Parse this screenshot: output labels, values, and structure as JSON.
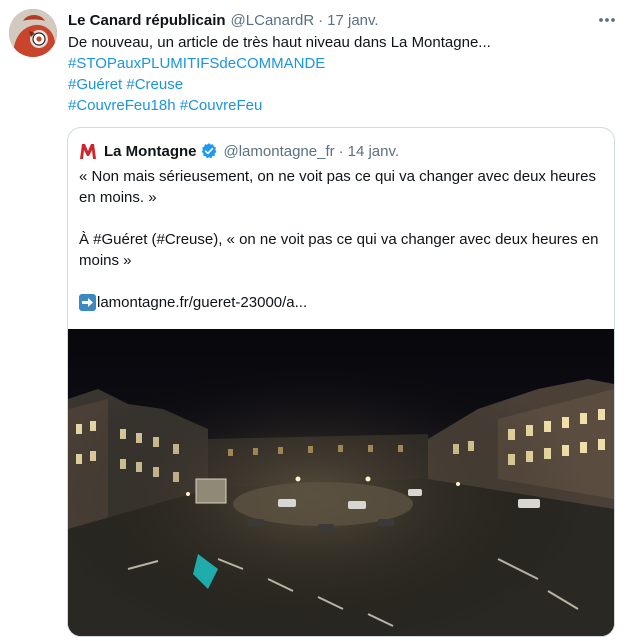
{
  "tweet": {
    "author_name": "Le Canard républicain",
    "author_handle": "@LCanardR",
    "separator": "·",
    "date": "17 janv.",
    "text": "De nouveau, un article de très haut niveau dans La Montagne...",
    "hashtag_lines": [
      [
        "#STOPauxPLUMITIFSdeCOMMANDE"
      ],
      [
        "#Guéret",
        "#Creuse"
      ],
      [
        "#CouvreFeu18h",
        "#CouvreFeu"
      ]
    ],
    "more_icon": "ellipsis-icon"
  },
  "quoted": {
    "author_name": "La Montagne",
    "author_handle": "@lamontagne_fr",
    "separator": "·",
    "date": "14 janv.",
    "logo_letter": "M",
    "paragraph1": "« Non mais sérieusement, on ne voit pas ce qui va changer avec deux heures en moins. »",
    "paragraph2": "À #Guéret (#Creuse), « on ne voit pas ce qui va changer avec deux heures en moins »",
    "link_text": "lamontagne.fr/gueret-23000/a...",
    "link_icon": "right-arrow-icon",
    "verified_icon": "verified-badge-icon"
  },
  "colors": {
    "link": "#1b95e0",
    "muted": "#5b7083",
    "logo_red": "#d0252c",
    "verified": "#1d9bf0",
    "avatar_bg": "#c8442c"
  }
}
